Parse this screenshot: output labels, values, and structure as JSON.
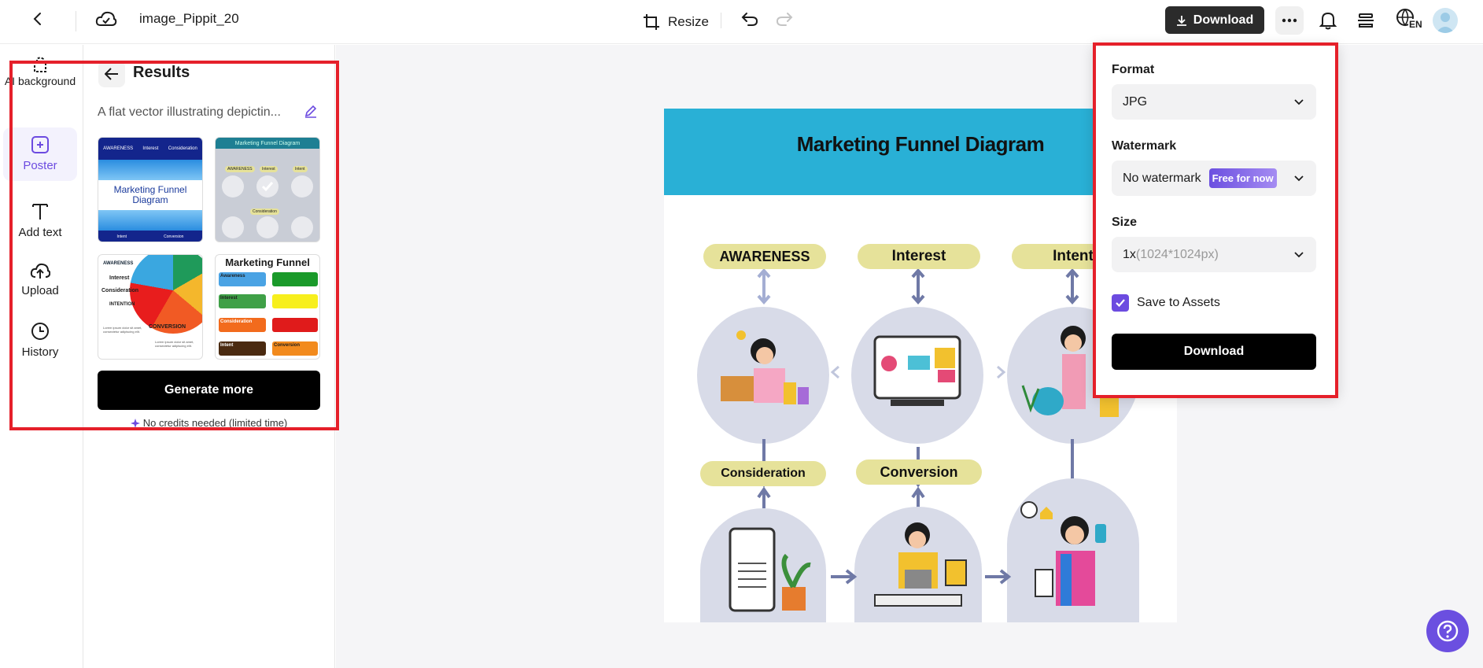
{
  "header": {
    "file_name": "image_Pippit_20",
    "resize_label": "Resize",
    "download_label": "Download",
    "lang_code": "EN"
  },
  "sidebar": {
    "items": [
      {
        "label": "AI background",
        "icon": "ai-background-icon"
      },
      {
        "label": "Poster",
        "icon": "poster-icon"
      },
      {
        "label": "Add text",
        "icon": "text-icon"
      },
      {
        "label": "Upload",
        "icon": "upload-icon"
      },
      {
        "label": "History",
        "icon": "history-icon"
      }
    ]
  },
  "panel": {
    "title": "Results",
    "prompt": "A flat vector illustrating depictin...",
    "thumbs": [
      {
        "title": "Marketing Funnel Diagram",
        "tags": [
          "AWARENESS",
          "Interest",
          "Consideration"
        ],
        "footer": [
          "Intent",
          "Conversion"
        ]
      },
      {
        "title": "Marketing Funnel Diagram",
        "tags": [
          "AWARENESS",
          "Interest",
          "Intent",
          "Consideration"
        ]
      },
      {
        "tags": [
          "AWARENESS",
          "Interest",
          "Consideration",
          "INTENTION",
          "CONVERSION"
        ],
        "body": "Lorem ipsum dolor sit amet, consectetur adipiscing elit."
      },
      {
        "title": "Marketing Funnel",
        "rows": [
          "Awareness",
          "Interest",
          "Consideration",
          "Intent",
          "Conversion"
        ]
      }
    ],
    "generate_label": "Generate more",
    "credits_note": "No credits needed (limited time)"
  },
  "poster": {
    "title": "Marketing Funnel Diagram",
    "stages": [
      "AWARENESS",
      "Interest",
      "Intent",
      "Consideration",
      "Conversion"
    ]
  },
  "download_panel": {
    "format_label": "Format",
    "format_value": "JPG",
    "watermark_label": "Watermark",
    "watermark_value": "No watermark",
    "watermark_badge": "Free for now",
    "size_label": "Size",
    "size_value": "1x",
    "size_detail": "(1024*1024px)",
    "save_label": "Save to Assets",
    "save_checked": true,
    "download_label": "Download"
  },
  "colors": {
    "accent": "#6c4be0",
    "highlight": "#e5202a",
    "poster_header": "#29b0d6",
    "pill": "#e6e29a",
    "help": "#6b4fe0"
  }
}
